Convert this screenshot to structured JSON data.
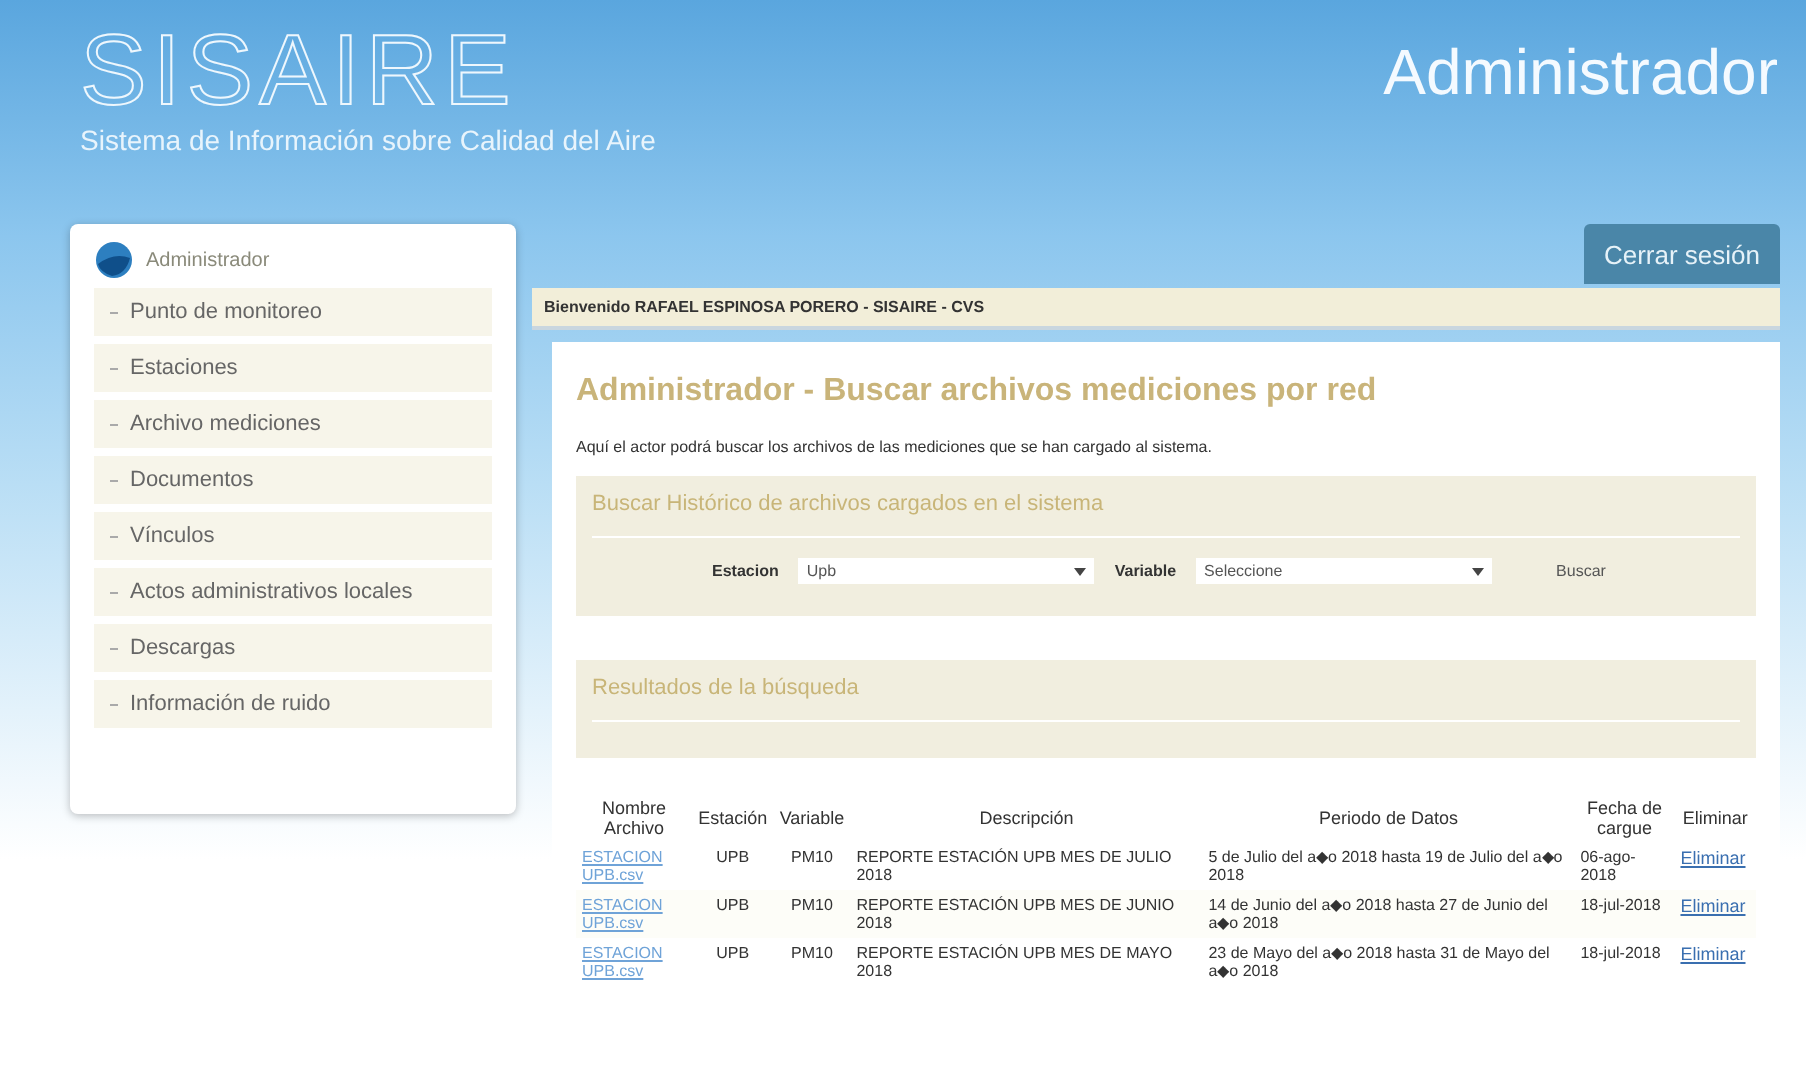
{
  "header": {
    "logo": "SISAIRE",
    "subtitle": "Sistema de Información sobre Calidad del Aire",
    "role": "Administrador",
    "logout": "Cerrar sesión"
  },
  "sidebar": {
    "title": "Administrador",
    "items": [
      "Punto de monitoreo",
      "Estaciones",
      "Archivo mediciones",
      "Documentos",
      "Vínculos",
      "Actos administrativos locales",
      "Descargas",
      "Información de ruido"
    ]
  },
  "welcome": "Bienvenido RAFAEL ESPINOSA PORERO - SISAIRE - CVS",
  "page_title": "Administrador - Buscar archivos mediciones por red",
  "intro": "Aquí el actor podrá buscar los archivos de las mediciones que se han cargado al sistema.",
  "search": {
    "title": "Buscar Histórico de archivos cargados en el sistema",
    "station_label": "Estacion",
    "station_value": "Upb",
    "variable_label": "Variable",
    "variable_value": "Seleccione",
    "button": "Buscar"
  },
  "results_title": "Resultados de la búsqueda",
  "table": {
    "columns": [
      "Nombre Archivo",
      "Estación",
      "Variable",
      "Descripción",
      "Periodo de Datos",
      "Fecha de cargue",
      "Eliminar"
    ],
    "rows": [
      {
        "file": "ESTACION UPB.csv",
        "station": "UPB",
        "variable": "PM10",
        "description": "REPORTE ESTACIÓN UPB MES DE JULIO 2018",
        "period": "5 de Julio del a◆o 2018 hasta 19 de Julio del a◆o 2018",
        "date": "06-ago-2018",
        "action": "Eliminar"
      },
      {
        "file": "ESTACION UPB.csv",
        "station": "UPB",
        "variable": "PM10",
        "description": "REPORTE ESTACIÓN UPB MES DE JUNIO 2018",
        "period": "14 de Junio del a◆o 2018 hasta 27 de Junio del a◆o 2018",
        "date": "18-jul-2018",
        "action": "Eliminar"
      },
      {
        "file": "ESTACION UPB.csv",
        "station": "UPB",
        "variable": "PM10",
        "description": "REPORTE ESTACIÓN UPB MES DE MAYO 2018",
        "period": "23 de Mayo del a◆o 2018 hasta 31 de Mayo del a◆o 2018",
        "date": "18-jul-2018",
        "action": "Eliminar"
      }
    ]
  }
}
